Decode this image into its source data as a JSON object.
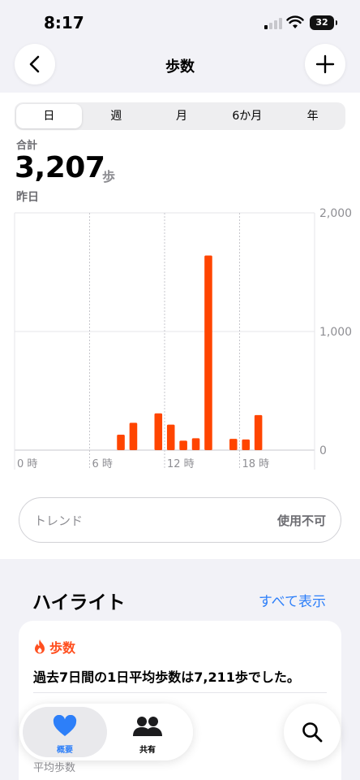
{
  "status_bar": {
    "time": "8:17",
    "battery": "32"
  },
  "nav": {
    "title": "歩数"
  },
  "segments": [
    {
      "label": "日",
      "active": true
    },
    {
      "label": "週",
      "active": false
    },
    {
      "label": "月",
      "active": false
    },
    {
      "label": "6か月",
      "active": false
    },
    {
      "label": "年",
      "active": false
    }
  ],
  "summary": {
    "total_label": "合計",
    "total_value": "3,207",
    "unit": "歩",
    "date": "昨日"
  },
  "chart_data": {
    "type": "bar",
    "x_unit": "hour",
    "x": [
      8,
      9,
      11,
      12,
      13,
      14,
      15,
      17,
      18,
      19
    ],
    "values": [
      130,
      230,
      310,
      215,
      80,
      100,
      1640,
      95,
      90,
      295
    ],
    "xlim": [
      0,
      24
    ],
    "ylim": [
      0,
      2000
    ],
    "y_ticks": [
      0,
      1000,
      2000
    ],
    "y_tick_labels": [
      "0",
      "1,000",
      "2,000"
    ],
    "x_ticks": [
      0,
      6,
      12,
      18
    ],
    "x_tick_labels": [
      "0 時",
      "6 時",
      "12 時",
      "18 時"
    ],
    "bar_color": "#ff4500",
    "grid": true
  },
  "trend": {
    "label": "トレンド",
    "value": "使用不可"
  },
  "highlights": {
    "title": "ハイライト",
    "show_all": "すべて表示",
    "card": {
      "category": "歩数",
      "icon": "flame-icon",
      "text": "過去7日間の1日平均歩数は7,211歩でした。",
      "sub_label": "平均歩数"
    }
  },
  "tab_bar": {
    "summary": {
      "label": "概要",
      "icon": "heart-icon"
    },
    "sharing": {
      "label": "共有",
      "icon": "people-icon"
    }
  },
  "colors": {
    "accent": "#2d7ff9",
    "steps": "#ff4500"
  }
}
